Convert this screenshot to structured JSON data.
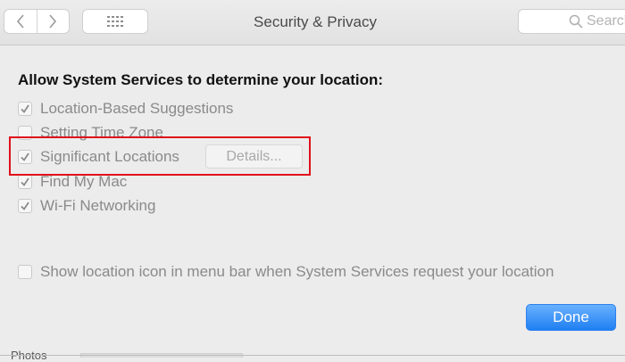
{
  "window": {
    "title": "Security & Privacy",
    "search_placeholder": "Search"
  },
  "heading": "Allow System Services to determine your location:",
  "services": [
    {
      "label": "Location-Based Suggestions",
      "checked": true
    },
    {
      "label": "Setting Time Zone",
      "checked": false
    },
    {
      "label": "Significant Locations",
      "checked": true
    },
    {
      "label": "Find My Mac",
      "checked": true
    },
    {
      "label": "Wi-Fi Networking",
      "checked": true
    }
  ],
  "details_label": "Details...",
  "show_icon": {
    "label": "Show location icon in menu bar when System Services request your location",
    "checked": false
  },
  "done_label": "Done",
  "underlying_text": "Photos",
  "colors": {
    "highlight": "#e0101b",
    "accent": "#1f7ff2"
  }
}
